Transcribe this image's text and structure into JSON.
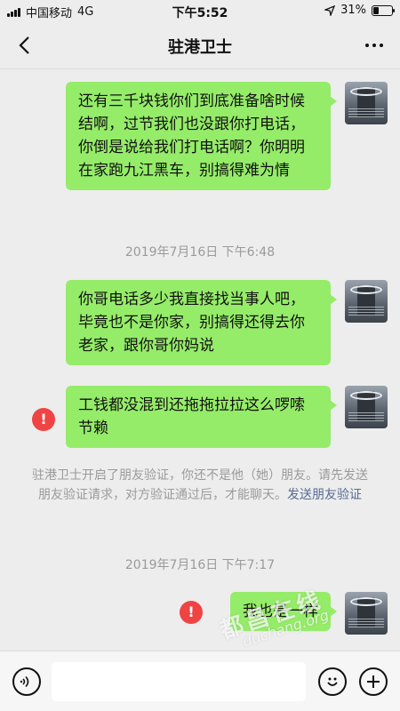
{
  "status_bar": {
    "carrier": "中国移动",
    "network": "4G",
    "time": "下午5:52",
    "battery": "31%",
    "battery_level": 0.31
  },
  "header": {
    "title": "驻港卫士"
  },
  "messages": [
    {
      "text": "还有三千块钱你们到底准备啥时候结啊，过节我们也没跟你打电话，你倒是说给我们打电话啊？你明明在家跑九江黑车，别搞得难为情"
    },
    {
      "text": "你哥电话多少我直接找当事人吧，毕竟也不是你家，别搞得还得去你老家，跟你哥你妈说"
    },
    {
      "text": "工钱都没混到还拖拖拉拉这么啰嗦节赖"
    },
    {
      "text": "我也是一样"
    }
  ],
  "timestamps": [
    "2019年7月16日 下午6:48",
    "2019年7月16日 下午7:17"
  ],
  "system_notice": {
    "text": "驻港卫士开启了朋友验证，你还不是他（她）朋友。请先发送朋友验证请求，对方验证通过后，才能聊天。",
    "link": "发送朋友验证"
  },
  "error_mark": "!",
  "watermark": {
    "line1": "都昌在线",
    "line2": "duchang.org"
  },
  "input": {
    "placeholder": ""
  },
  "colors": {
    "bubble": "#95ec69",
    "error": "#f04343",
    "link": "#576b95",
    "background": "#ededed"
  },
  "icons": [
    "back-icon",
    "more-icon",
    "voice-icon",
    "emoji-icon",
    "plus-icon",
    "error-icon"
  ]
}
